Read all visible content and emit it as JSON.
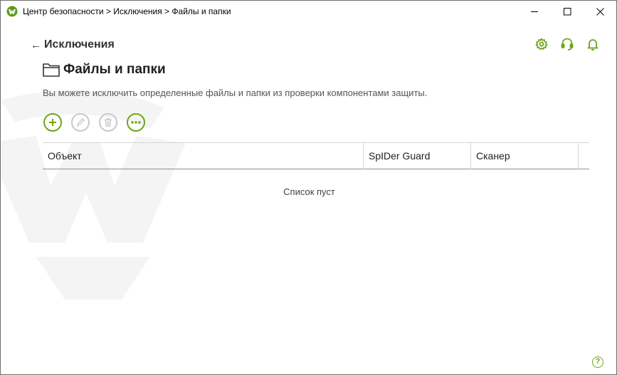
{
  "window": {
    "title": "Центр безопасности > Исключения > Файлы и папки",
    "controls": {
      "minimize": "minimize-icon",
      "maximize": "maximize-icon",
      "close": "close-icon"
    }
  },
  "header": {
    "back_label": "Исключения",
    "back_icon": "arrow-left-icon",
    "icons": [
      "gear-icon",
      "headset-icon",
      "bell-icon"
    ]
  },
  "page": {
    "title": "Файлы и папки",
    "title_icon": "folder-icon",
    "description": "Вы можете исключить определенные файлы и папки из проверки компонентами защиты."
  },
  "toolbar": {
    "buttons": [
      {
        "icon": "plus-icon",
        "enabled": true
      },
      {
        "icon": "pencil-icon",
        "enabled": false
      },
      {
        "icon": "trash-icon",
        "enabled": false
      },
      {
        "icon": "more-icon",
        "enabled": true
      }
    ]
  },
  "table": {
    "columns": [
      "Объект",
      "SpIDer Guard",
      "Сканер"
    ],
    "empty_text": "Список пуст"
  },
  "footer": {
    "help_label": "?"
  },
  "colors": {
    "accent": "#6ca61c",
    "disabled": "#c9c9c9"
  }
}
